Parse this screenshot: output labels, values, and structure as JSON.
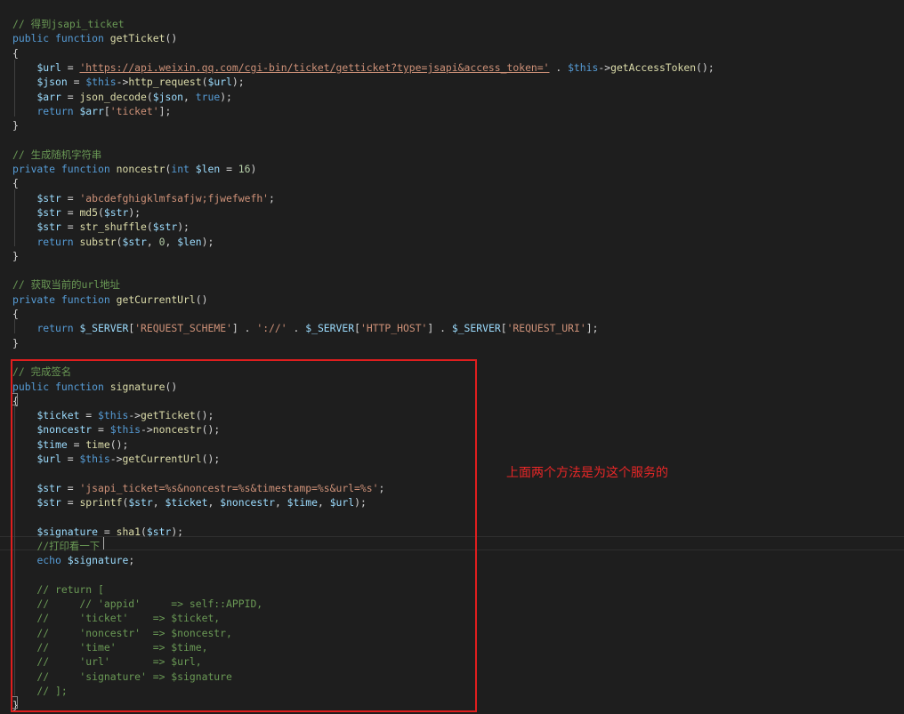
{
  "colors": {
    "background": "#1e1e1e",
    "comment": "#6a9955",
    "keyword": "#569cd6",
    "function": "#dcdcaa",
    "variable": "#9cdcfe",
    "string": "#ce9178",
    "number": "#b5cea8",
    "plain": "#d4d4d4",
    "annotation_box": "#e01e1e"
  },
  "annotation": {
    "text": "上面两个方法是为这个服务的"
  },
  "code_lines": [
    [
      [
        "// 得到jsapi_ticket",
        "comment"
      ]
    ],
    [
      [
        "public",
        "keyword"
      ],
      [
        " ",
        "plain"
      ],
      [
        "function",
        "keyword"
      ],
      [
        " ",
        "plain"
      ],
      [
        "getTicket",
        "func"
      ],
      [
        "()",
        "plain"
      ]
    ],
    [
      [
        "{",
        "plain"
      ]
    ],
    [
      [
        "    ",
        "plain"
      ],
      [
        "$url",
        "var"
      ],
      [
        " = ",
        "plain"
      ],
      [
        "'https://api.weixin.qq.com/cgi-bin/ticket/getticket?type=jsapi&access_token='",
        "string"
      ],
      [
        " . ",
        "plain"
      ],
      [
        "$this",
        "this"
      ],
      [
        "->",
        "plain"
      ],
      [
        "getAccessToken",
        "func"
      ],
      [
        "();",
        "plain"
      ]
    ],
    [
      [
        "    ",
        "plain"
      ],
      [
        "$json",
        "var"
      ],
      [
        " = ",
        "plain"
      ],
      [
        "$this",
        "this"
      ],
      [
        "->",
        "plain"
      ],
      [
        "http_request",
        "func"
      ],
      [
        "(",
        "plain"
      ],
      [
        "$url",
        "var"
      ],
      [
        ");",
        "plain"
      ]
    ],
    [
      [
        "    ",
        "plain"
      ],
      [
        "$arr",
        "var"
      ],
      [
        " = ",
        "plain"
      ],
      [
        "json_decode",
        "func"
      ],
      [
        "(",
        "plain"
      ],
      [
        "$json",
        "var"
      ],
      [
        ", ",
        "plain"
      ],
      [
        "true",
        "keyword"
      ],
      [
        ");",
        "plain"
      ]
    ],
    [
      [
        "    ",
        "plain"
      ],
      [
        "return",
        "keyword"
      ],
      [
        " ",
        "plain"
      ],
      [
        "$arr",
        "var"
      ],
      [
        "[",
        "plain"
      ],
      [
        "'ticket'",
        "string"
      ],
      [
        "];",
        "plain"
      ]
    ],
    [
      [
        "}",
        "plain"
      ]
    ],
    [
      [
        "",
        "plain"
      ]
    ],
    [
      [
        "// 生成随机字符串",
        "comment"
      ]
    ],
    [
      [
        "private",
        "keyword"
      ],
      [
        " ",
        "plain"
      ],
      [
        "function",
        "keyword"
      ],
      [
        " ",
        "plain"
      ],
      [
        "noncestr",
        "func"
      ],
      [
        "(",
        "plain"
      ],
      [
        "int",
        "keyword"
      ],
      [
        " ",
        "plain"
      ],
      [
        "$len",
        "var"
      ],
      [
        " = ",
        "plain"
      ],
      [
        "16",
        "number"
      ],
      [
        ")",
        "plain"
      ]
    ],
    [
      [
        "{",
        "plain"
      ]
    ],
    [
      [
        "    ",
        "plain"
      ],
      [
        "$str",
        "var"
      ],
      [
        " = ",
        "plain"
      ],
      [
        "'abcdefghigklmfsafjw;fjwefwefh'",
        "string"
      ],
      [
        ";",
        "plain"
      ]
    ],
    [
      [
        "    ",
        "plain"
      ],
      [
        "$str",
        "var"
      ],
      [
        " = ",
        "plain"
      ],
      [
        "md5",
        "func"
      ],
      [
        "(",
        "plain"
      ],
      [
        "$str",
        "var"
      ],
      [
        ");",
        "plain"
      ]
    ],
    [
      [
        "    ",
        "plain"
      ],
      [
        "$str",
        "var"
      ],
      [
        " = ",
        "plain"
      ],
      [
        "str_shuffle",
        "func"
      ],
      [
        "(",
        "plain"
      ],
      [
        "$str",
        "var"
      ],
      [
        ");",
        "plain"
      ]
    ],
    [
      [
        "    ",
        "plain"
      ],
      [
        "return",
        "keyword"
      ],
      [
        " ",
        "plain"
      ],
      [
        "substr",
        "func"
      ],
      [
        "(",
        "plain"
      ],
      [
        "$str",
        "var"
      ],
      [
        ", ",
        "plain"
      ],
      [
        "0",
        "number"
      ],
      [
        ", ",
        "plain"
      ],
      [
        "$len",
        "var"
      ],
      [
        ");",
        "plain"
      ]
    ],
    [
      [
        "}",
        "plain"
      ]
    ],
    [
      [
        "",
        "plain"
      ]
    ],
    [
      [
        "// 获取当前的url地址",
        "comment"
      ]
    ],
    [
      [
        "private",
        "keyword"
      ],
      [
        " ",
        "plain"
      ],
      [
        "function",
        "keyword"
      ],
      [
        " ",
        "plain"
      ],
      [
        "getCurrentUrl",
        "func"
      ],
      [
        "()",
        "plain"
      ]
    ],
    [
      [
        "{",
        "plain"
      ]
    ],
    [
      [
        "    ",
        "plain"
      ],
      [
        "return",
        "keyword"
      ],
      [
        " ",
        "plain"
      ],
      [
        "$_SERVER",
        "var"
      ],
      [
        "[",
        "plain"
      ],
      [
        "'REQUEST_SCHEME'",
        "string"
      ],
      [
        "] . ",
        "plain"
      ],
      [
        "'://'",
        "string"
      ],
      [
        " . ",
        "plain"
      ],
      [
        "$_SERVER",
        "var"
      ],
      [
        "[",
        "plain"
      ],
      [
        "'HTTP_HOST'",
        "string"
      ],
      [
        "] . ",
        "plain"
      ],
      [
        "$_SERVER",
        "var"
      ],
      [
        "[",
        "plain"
      ],
      [
        "'REQUEST_URI'",
        "string"
      ],
      [
        "];",
        "plain"
      ]
    ],
    [
      [
        "}",
        "plain"
      ]
    ],
    [
      [
        "",
        "plain"
      ]
    ],
    [
      [
        "// 完成签名",
        "comment"
      ]
    ],
    [
      [
        "public",
        "keyword"
      ],
      [
        " ",
        "plain"
      ],
      [
        "function",
        "keyword"
      ],
      [
        " ",
        "plain"
      ],
      [
        "signature",
        "func"
      ],
      [
        "()",
        "plain"
      ]
    ],
    [
      [
        "{",
        "plain"
      ]
    ],
    [
      [
        "    ",
        "plain"
      ],
      [
        "$ticket",
        "var"
      ],
      [
        " = ",
        "plain"
      ],
      [
        "$this",
        "this"
      ],
      [
        "->",
        "plain"
      ],
      [
        "getTicket",
        "func"
      ],
      [
        "();",
        "plain"
      ]
    ],
    [
      [
        "    ",
        "plain"
      ],
      [
        "$noncestr",
        "var"
      ],
      [
        " = ",
        "plain"
      ],
      [
        "$this",
        "this"
      ],
      [
        "->",
        "plain"
      ],
      [
        "noncestr",
        "func"
      ],
      [
        "();",
        "plain"
      ]
    ],
    [
      [
        "    ",
        "plain"
      ],
      [
        "$time",
        "var"
      ],
      [
        " = ",
        "plain"
      ],
      [
        "time",
        "func"
      ],
      [
        "();",
        "plain"
      ]
    ],
    [
      [
        "    ",
        "plain"
      ],
      [
        "$url",
        "var"
      ],
      [
        " = ",
        "plain"
      ],
      [
        "$this",
        "this"
      ],
      [
        "->",
        "plain"
      ],
      [
        "getCurrentUrl",
        "func"
      ],
      [
        "();",
        "plain"
      ]
    ],
    [
      [
        "",
        "plain"
      ]
    ],
    [
      [
        "    ",
        "plain"
      ],
      [
        "$str",
        "var"
      ],
      [
        " = ",
        "plain"
      ],
      [
        "'jsapi_ticket=%s&noncestr=%s&timestamp=%s&url=%s'",
        "string"
      ],
      [
        ";",
        "plain"
      ]
    ],
    [
      [
        "    ",
        "plain"
      ],
      [
        "$str",
        "var"
      ],
      [
        " = ",
        "plain"
      ],
      [
        "sprintf",
        "func"
      ],
      [
        "(",
        "plain"
      ],
      [
        "$str",
        "var"
      ],
      [
        ", ",
        "plain"
      ],
      [
        "$ticket",
        "var"
      ],
      [
        ", ",
        "plain"
      ],
      [
        "$noncestr",
        "var"
      ],
      [
        ", ",
        "plain"
      ],
      [
        "$time",
        "var"
      ],
      [
        ", ",
        "plain"
      ],
      [
        "$url",
        "var"
      ],
      [
        ");",
        "plain"
      ]
    ],
    [
      [
        "",
        "plain"
      ]
    ],
    [
      [
        "    ",
        "plain"
      ],
      [
        "$signature",
        "var"
      ],
      [
        " = ",
        "plain"
      ],
      [
        "sha1",
        "func"
      ],
      [
        "(",
        "plain"
      ],
      [
        "$str",
        "var"
      ],
      [
        ");",
        "plain"
      ]
    ],
    [
      [
        "    ",
        "plain"
      ],
      [
        "//打印看一下",
        "comment"
      ]
    ],
    [
      [
        "    ",
        "plain"
      ],
      [
        "echo",
        "keyword"
      ],
      [
        " ",
        "plain"
      ],
      [
        "$signature",
        "var"
      ],
      [
        ";",
        "plain"
      ]
    ],
    [
      [
        "",
        "plain"
      ]
    ],
    [
      [
        "    // return [",
        "comment"
      ]
    ],
    [
      [
        "    //     // 'appid'     => self::APPID,",
        "comment"
      ]
    ],
    [
      [
        "    //     'ticket'    => $ticket,",
        "comment"
      ]
    ],
    [
      [
        "    //     'noncestr'  => $noncestr,",
        "comment"
      ]
    ],
    [
      [
        "    //     'time'      => $time,",
        "comment"
      ]
    ],
    [
      [
        "    //     'url'       => $url,",
        "comment"
      ]
    ],
    [
      [
        "    //     'signature' => $signature",
        "comment"
      ]
    ],
    [
      [
        "    // ];",
        "comment"
      ]
    ],
    [
      [
        "}",
        "plain"
      ]
    ]
  ]
}
